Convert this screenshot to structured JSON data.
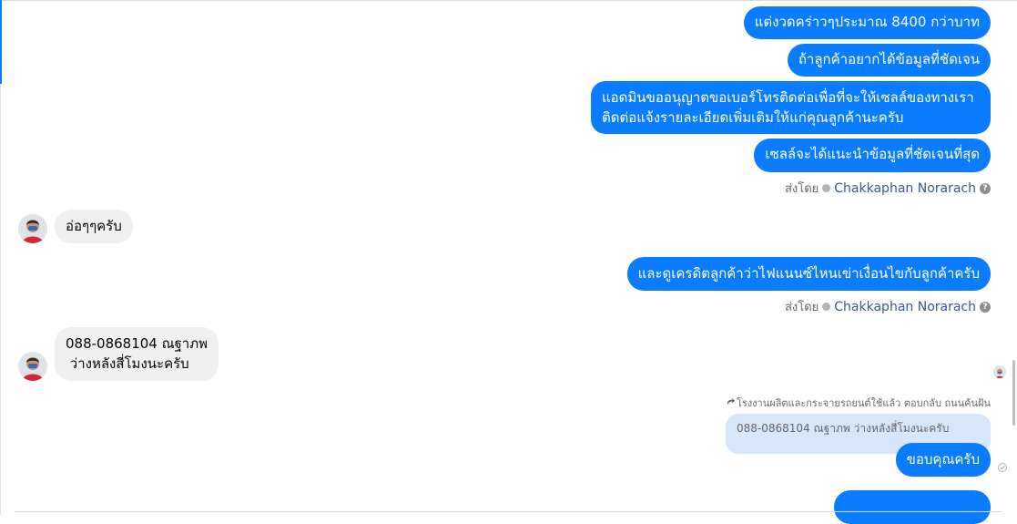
{
  "messages_out": [
    {
      "id": "m1",
      "text": "แต่งวดคร่าวๆประมาณ 8400 กว่าบาท"
    },
    {
      "id": "m2",
      "text": "ถ้าลูกค้าอยากได้ข้อมูลที่ชัดเจน"
    },
    {
      "id": "m3",
      "lines": [
        "แอดมินขออนุญาตขอเบอร์โทรติดต่อเพื่อที่จะให้เซลล์ของทางเรา",
        "ติดต่อแจ้งรายละเอียดเพิ่มเติมให้แก่คุณลูกค้านะครับ"
      ]
    },
    {
      "id": "m4",
      "text": "เซลล์จะได้แนะนำข้อมูลที่ชัดเจนที่สุด"
    },
    {
      "id": "m5",
      "text": "และดูเครดิตลูกค้าว่าไฟแนนซ์ไหนเข่าเงื่อนไขกับลูกค้าครับ"
    },
    {
      "id": "m6",
      "text": "ขอบคุณครับ"
    }
  ],
  "sent_by": {
    "prefix": "ส่งโดย",
    "name": "Chakkaphan Norarach",
    "help": "?"
  },
  "messages_in": [
    {
      "id": "r1",
      "text": "อ่อๆๆครับ"
    },
    {
      "id": "r2",
      "lines": [
        "088-0868104 ณฐาภพ",
        " ว่างหลังสี่โมงนะครับ"
      ]
    }
  ],
  "reply": {
    "header": "โรงงานผลิตและกระจายรถยนต์ใช้แล้ว ตอบกลับ ถนนค้นฝัน",
    "quote": "088-0868104 ณฐาภพ ว่างหลังสี่โมงนะครับ"
  },
  "colors": {
    "outgoing_bubble": "#0a7cff",
    "incoming_bubble": "#f0f0f0",
    "quote_bubble": "#d6e6fb",
    "sender_name": "#385898"
  },
  "icons": {
    "avatar": "user-avatar",
    "verified": "verified-badge-icon",
    "help": "help-icon",
    "reply": "reply-arrow-icon",
    "seen": "seen-check-icon"
  }
}
